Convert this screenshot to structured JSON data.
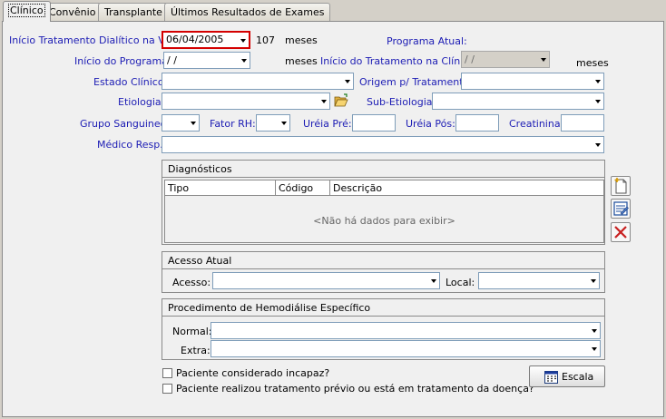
{
  "tabs": [
    {
      "label": "Clínico"
    },
    {
      "label": "Convênio"
    },
    {
      "label": "Transplante"
    },
    {
      "label": "Últimos Resultados de Exames"
    }
  ],
  "form": {
    "inicio_tratamento_label": "Início Tratamento Dialítico na Vida:",
    "inicio_tratamento_value": "06/04/2005",
    "meses_count": "107",
    "meses_label": "meses",
    "programa_atual_label": "Programa Atual:",
    "inicio_programa_label": "Início do Programa:",
    "inicio_programa_value": " /  /",
    "meses_label2": "meses",
    "inicio_clinica_label": "Início do Tratamento na Clínica:",
    "inicio_clinica_value": " /  /",
    "meses_label3": "meses",
    "estado_clinico_label": "Estado Clínico:",
    "origem_label": "Origem p/ Tratamento:",
    "etiologia_label": "Etiologia:",
    "sub_etiologia_label": "Sub-Etiologia:",
    "grupo_sanguineo_label": "Grupo Sanguineo:",
    "fator_rh_label": "Fator RH:",
    "ureia_pre_label": "Uréia Pré:",
    "ureia_pos_label": "Uréia Pós:",
    "creatinina_label": "Creatinina:",
    "medico_label": "Médico Resp.:"
  },
  "diagnosticos": {
    "title": "Diagnósticos",
    "columns": [
      "Tipo",
      "Código",
      "Descrição"
    ],
    "empty_text": "<Não há dados para exibir>"
  },
  "acesso": {
    "title": "Acesso Atual",
    "acesso_label": "Acesso:",
    "local_label": "Local:"
  },
  "procedimento": {
    "title": "Procedimento de Hemodiálise Específico",
    "normal_label": "Normal:",
    "extra_label": "Extra:"
  },
  "checkboxes": {
    "incapaz_label": "Paciente considerado incapaz?",
    "tratamento_previo_label": "Paciente realizou tratamento prévio ou está em tratamento da doença?"
  },
  "buttons": {
    "escala_label": "Escala"
  },
  "colors": {
    "label_blue": "#1c1cb4",
    "highlight_red": "#d40000",
    "panel_bg": "#f0f0f0"
  }
}
